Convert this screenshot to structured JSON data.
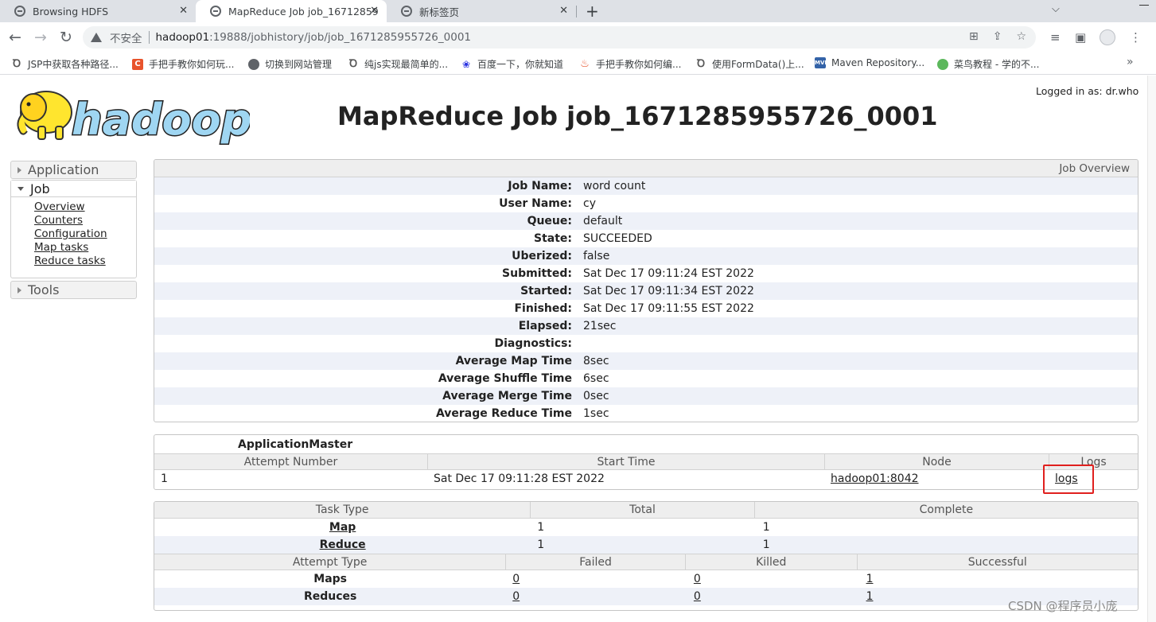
{
  "browser": {
    "tabs": [
      {
        "title": "Browsing HDFS"
      },
      {
        "title": "MapReduce Job job_16712859"
      },
      {
        "title": "新标签页"
      }
    ],
    "security_label": "不安全",
    "url_host": "hadoop01",
    "url_path": ":19888/jobhistory/job/job_1671285955726_0001",
    "bookmarks": [
      "JSP中获取各种路径...",
      "手把手教你如何玩...",
      "切换到网站管理",
      "纯js实现最简单的...",
      "百度一下，你就知道",
      "手把手教你如何编...",
      "使用FormData()上...",
      "Maven Repository...",
      "菜鸟教程 - 学的不..."
    ]
  },
  "header": {
    "logo_text": "hadoop",
    "logged_in": "Logged in as: dr.who",
    "title": "MapReduce Job job_1671285955726_0001"
  },
  "sidebar": {
    "application": "Application",
    "job": "Job",
    "job_links": [
      "Overview",
      "Counters",
      "Configuration",
      "Map tasks",
      "Reduce tasks"
    ],
    "tools": "Tools"
  },
  "overview": {
    "heading": "Job Overview",
    "rows": [
      {
        "k": "Job Name:",
        "v": "word count"
      },
      {
        "k": "User Name:",
        "v": "cy"
      },
      {
        "k": "Queue:",
        "v": "default"
      },
      {
        "k": "State:",
        "v": "SUCCEEDED"
      },
      {
        "k": "Uberized:",
        "v": "false"
      },
      {
        "k": "Submitted:",
        "v": "Sat Dec 17 09:11:24 EST 2022"
      },
      {
        "k": "Started:",
        "v": "Sat Dec 17 09:11:34 EST 2022"
      },
      {
        "k": "Finished:",
        "v": "Sat Dec 17 09:11:55 EST 2022"
      },
      {
        "k": "Elapsed:",
        "v": "21sec"
      },
      {
        "k": "Diagnostics:",
        "v": ""
      },
      {
        "k": "Average Map Time",
        "v": "8sec"
      },
      {
        "k": "Average Shuffle Time",
        "v": "6sec"
      },
      {
        "k": "Average Merge Time",
        "v": "0sec"
      },
      {
        "k": "Average Reduce Time",
        "v": "1sec"
      }
    ]
  },
  "app_master": {
    "title": "ApplicationMaster",
    "headers": [
      "Attempt Number",
      "Start Time",
      "Node",
      "Logs"
    ],
    "row": {
      "attempt": "1",
      "start": "Sat Dec 17 09:11:28 EST 2022",
      "node": "hadoop01:8042",
      "logs": "logs"
    }
  },
  "tasks": {
    "headers": [
      "Task Type",
      "Total",
      "Complete"
    ],
    "rows": [
      {
        "type": "Map",
        "total": "1",
        "complete": "1"
      },
      {
        "type": "Reduce",
        "total": "1",
        "complete": "1"
      }
    ],
    "attempt_headers": [
      "Attempt Type",
      "Failed",
      "Killed",
      "Successful"
    ],
    "attempt_rows": [
      {
        "type": "Maps",
        "failed": "0",
        "killed": "0",
        "successful": "1"
      },
      {
        "type": "Reduces",
        "failed": "0",
        "killed": "0",
        "successful": "1"
      }
    ]
  },
  "watermark": "CSDN @程序员小庞"
}
